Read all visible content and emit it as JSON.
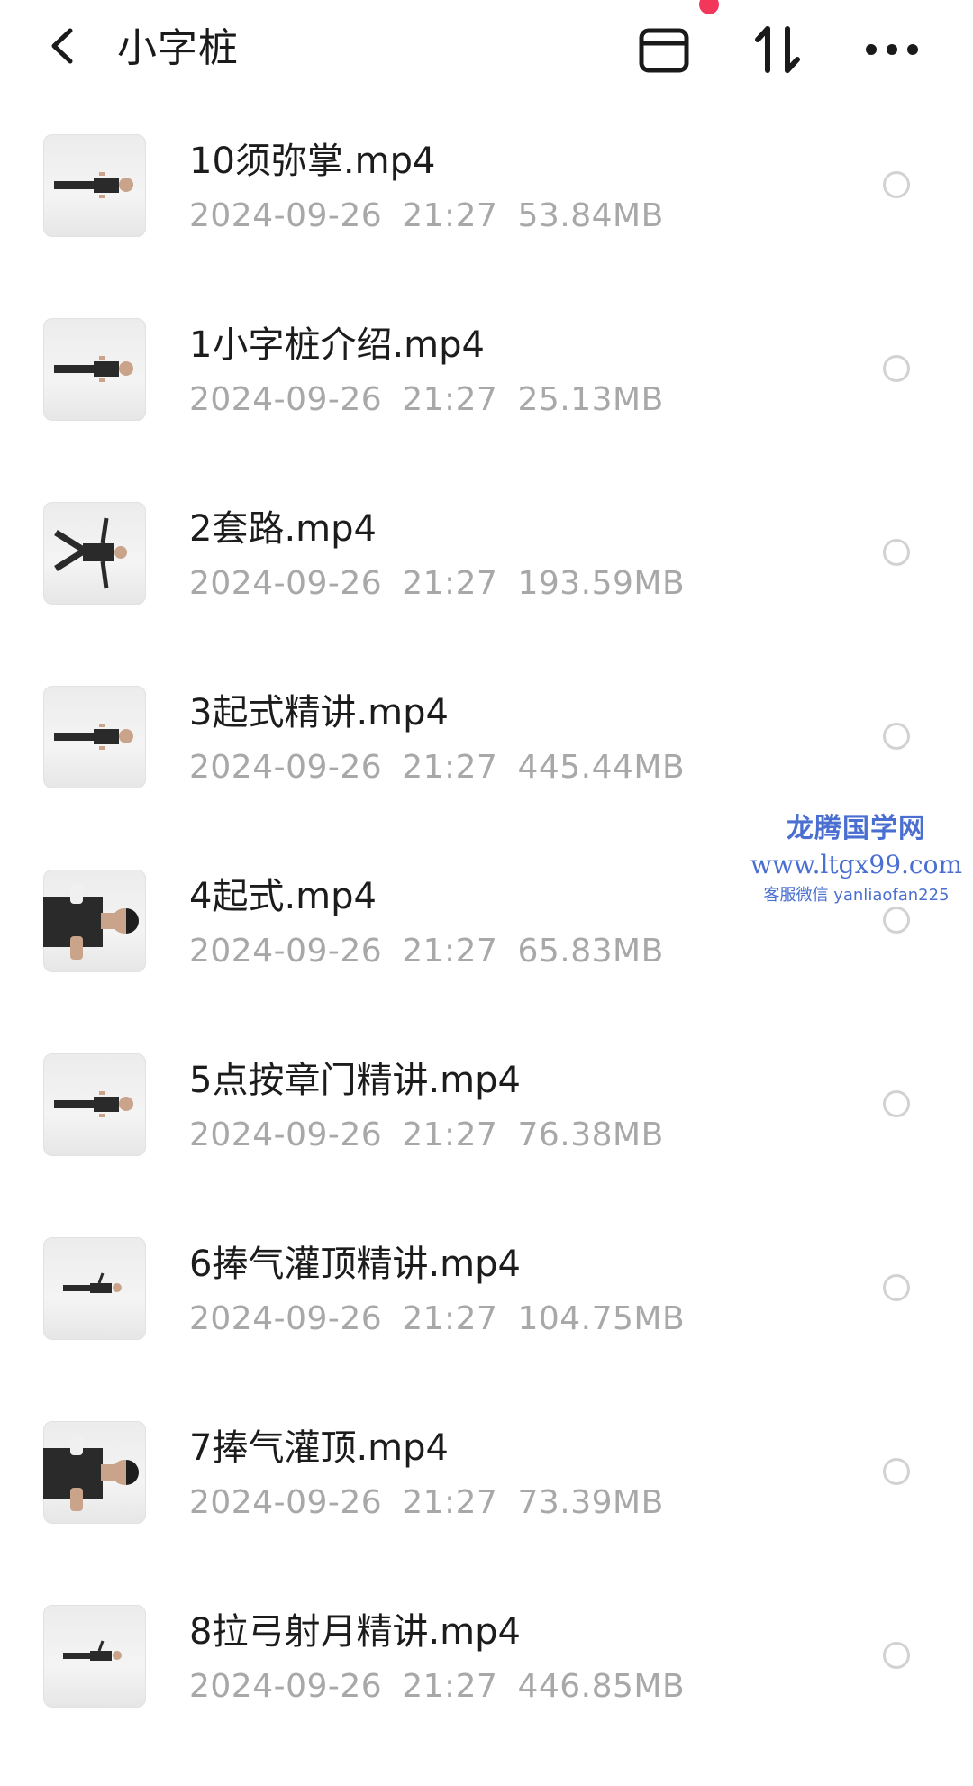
{
  "header": {
    "title": "小字桩",
    "icons": {
      "back": "chevron-left-icon",
      "select": "select-box-icon",
      "sort": "sort-arrows-icon",
      "more": "more-dots-icon"
    },
    "notification_dot_color": "#f2375a"
  },
  "files": [
    {
      "name": "10须弥掌.mp4",
      "date": "2024-09-26",
      "time": "21:27",
      "size": "53.84MB",
      "pose": "stand"
    },
    {
      "name": "1小字桩介绍.mp4",
      "date": "2024-09-26",
      "time": "21:27",
      "size": "25.13MB",
      "pose": "stand"
    },
    {
      "name": "2套路.mp4",
      "date": "2024-09-26",
      "time": "21:27",
      "size": "193.59MB",
      "pose": "wide"
    },
    {
      "name": "3起式精讲.mp4",
      "date": "2024-09-26",
      "time": "21:27",
      "size": "445.44MB",
      "pose": "stand"
    },
    {
      "name": "4起式.mp4",
      "date": "2024-09-26",
      "time": "21:27",
      "size": "65.83MB",
      "pose": "close"
    },
    {
      "name": "5点按章门精讲.mp4",
      "date": "2024-09-26",
      "time": "21:27",
      "size": "76.38MB",
      "pose": "stand"
    },
    {
      "name": "6捧气灌顶精讲.mp4",
      "date": "2024-09-26",
      "time": "21:27",
      "size": "104.75MB",
      "pose": "far"
    },
    {
      "name": "7捧气灌顶.mp4",
      "date": "2024-09-26",
      "time": "21:27",
      "size": "73.39MB",
      "pose": "close"
    },
    {
      "name": "8拉弓射月精讲.mp4",
      "date": "2024-09-26",
      "time": "21:27",
      "size": "446.85MB",
      "pose": "far"
    }
  ],
  "watermark": {
    "line1": "龙腾国学网",
    "line2": "www.ltgx99.com",
    "line3": "客服微信 yanliaofan225"
  },
  "colors": {
    "meta_text": "#a8a8a8",
    "watermark": "#4a6fd0"
  }
}
